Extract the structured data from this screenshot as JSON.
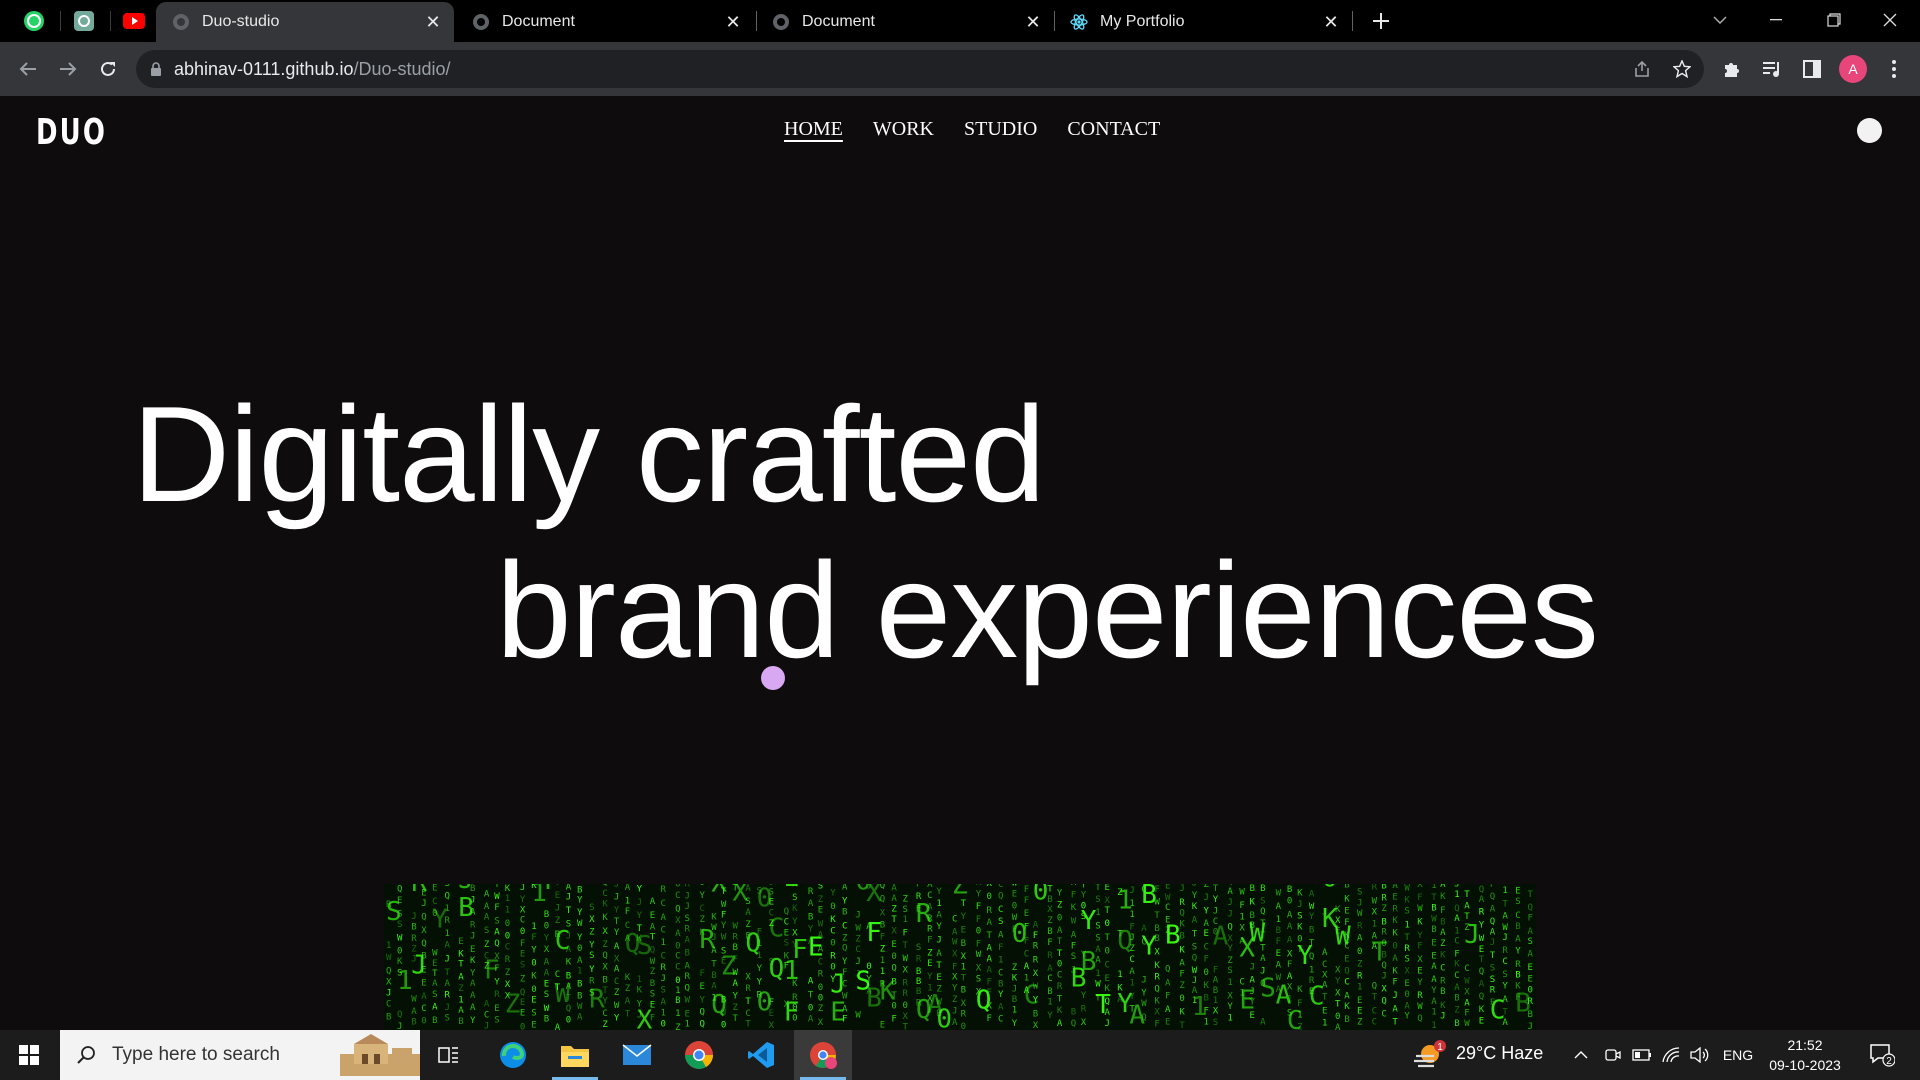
{
  "browser": {
    "tabs": [
      {
        "title": "Duo-studio",
        "active": true
      },
      {
        "title": "Document",
        "active": false
      },
      {
        "title": "Document",
        "active": false
      },
      {
        "title": "My Portfolio",
        "active": false
      }
    ],
    "pinned_tabs": [
      "whatsapp-icon",
      "chatgpt-icon",
      "youtube-icon"
    ],
    "url_host": "abhinav-0111.github.io",
    "url_path": "/Duo-studio/",
    "profile_initial": "A"
  },
  "site": {
    "logo": "DUO",
    "nav": [
      "HOME",
      "WORK",
      "STUDIO",
      "CONTACT"
    ],
    "active_nav": "HOME",
    "hero_line1": "Digitally crafted",
    "hero_line2": "brand experiences"
  },
  "taskbar": {
    "search_placeholder": "Type here to search",
    "weather": "29°C  Haze",
    "weather_badge": "1",
    "language": "ENG",
    "time": "21:52",
    "date": "09-10-2023",
    "notifications": "2"
  },
  "colors": {
    "page_bg": "#0e0c0c",
    "cursor_dot": "#d8a8f2",
    "matrix_green": "#39ff14",
    "profile_avatar": "#e8457a"
  }
}
